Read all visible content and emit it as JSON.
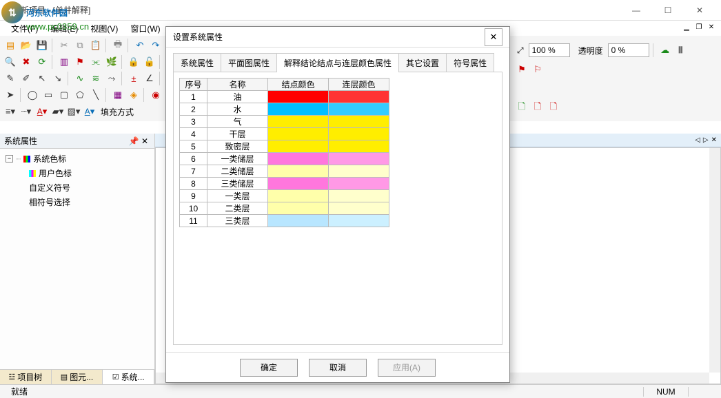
{
  "window": {
    "title": "新项目 - [单井解释]"
  },
  "watermark": {
    "brand": "河东软件园",
    "url": "www.pc0359.cn"
  },
  "menu": {
    "items": [
      "文件(F)",
      "编辑(E)",
      "视图(V)",
      "窗口(W)"
    ]
  },
  "toolbars": {
    "zoom_value": "100 %",
    "opacity_label": "透明度",
    "opacity_value": "0 %",
    "fill_label": "填充方式"
  },
  "side_panel": {
    "header": "系统属性",
    "tree": {
      "root": "系统色标",
      "user": "用户色标",
      "custom": "自定义符号",
      "similar": "相符号选择"
    },
    "tabs": [
      "项目树",
      "图元...",
      "系统..."
    ]
  },
  "dialog": {
    "title": "设置系统属性",
    "tabs": [
      "系统属性",
      "平面图属性",
      "解释结论结点与连层颜色属性",
      "其它设置",
      "符号属性"
    ],
    "active_tab": 2,
    "table": {
      "headers": [
        "序号",
        "名称",
        "结点颜色",
        "连层颜色"
      ],
      "rows": [
        {
          "idx": "1",
          "name": "油",
          "c1": "#ff0000",
          "c2": "#ff3333"
        },
        {
          "idx": "2",
          "name": "水",
          "c1": "#00bfff",
          "c2": "#33ccff"
        },
        {
          "idx": "3",
          "name": "气",
          "c1": "#ffee00",
          "c2": "#ffee00"
        },
        {
          "idx": "4",
          "name": "干层",
          "c1": "#ffee00",
          "c2": "#ffee00"
        },
        {
          "idx": "5",
          "name": "致密层",
          "c1": "#ffee00",
          "c2": "#ffee00"
        },
        {
          "idx": "6",
          "name": "一类储层",
          "c1": "#ff77dd",
          "c2": "#ff99e6"
        },
        {
          "idx": "7",
          "name": "二类储层",
          "c1": "#ffffaa",
          "c2": "#ffffcc"
        },
        {
          "idx": "8",
          "name": "三类储层",
          "c1": "#ff77dd",
          "c2": "#ff99e6"
        },
        {
          "idx": "9",
          "name": "一类层",
          "c1": "#ffffaa",
          "c2": "#ffffcc"
        },
        {
          "idx": "10",
          "name": "二类层",
          "c1": "#ffffaa",
          "c2": "#ffffcc"
        },
        {
          "idx": "11",
          "name": "三类层",
          "c1": "#b8e6ff",
          "c2": "#ccf0ff"
        }
      ]
    },
    "buttons": {
      "ok": "确定",
      "cancel": "取消",
      "apply": "应用(A)"
    }
  },
  "status": {
    "ready": "就绪",
    "num": "NUM"
  }
}
